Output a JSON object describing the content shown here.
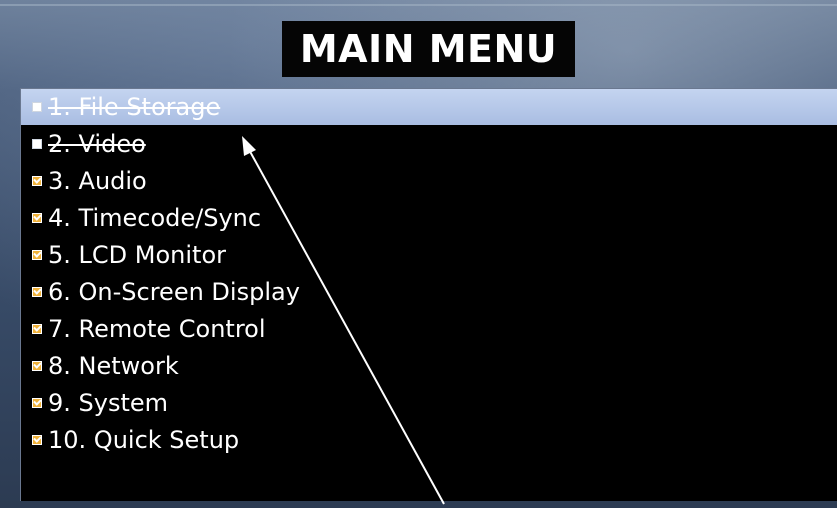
{
  "screen": {
    "title": "MAIN MENU"
  },
  "menu": {
    "items": [
      {
        "label": "1. File Storage",
        "enabled": false,
        "selected": true
      },
      {
        "label": "2. Video",
        "enabled": false,
        "selected": false
      },
      {
        "label": "3. Audio",
        "enabled": true,
        "selected": false
      },
      {
        "label": "4. Timecode/Sync",
        "enabled": true,
        "selected": false
      },
      {
        "label": "5. LCD Monitor",
        "enabled": true,
        "selected": false
      },
      {
        "label": "6. On-Screen Display",
        "enabled": true,
        "selected": false
      },
      {
        "label": "7. Remote Control",
        "enabled": true,
        "selected": false
      },
      {
        "label": "8. Network",
        "enabled": true,
        "selected": false
      },
      {
        "label": "9. System",
        "enabled": true,
        "selected": false
      },
      {
        "label": "10. Quick Setup",
        "enabled": true,
        "selected": false
      }
    ]
  },
  "colors": {
    "selection_highlight": "#b4c6e8",
    "checkbox_enabled": "#f0b23a",
    "panel_background": "#000000",
    "annotation_arrow": "#ffffff"
  },
  "icons": {
    "checkbox_enabled": "checkbox-checked-icon",
    "checkbox_disabled": "checkbox-unchecked-icon",
    "annotation": "arrow-icon"
  }
}
